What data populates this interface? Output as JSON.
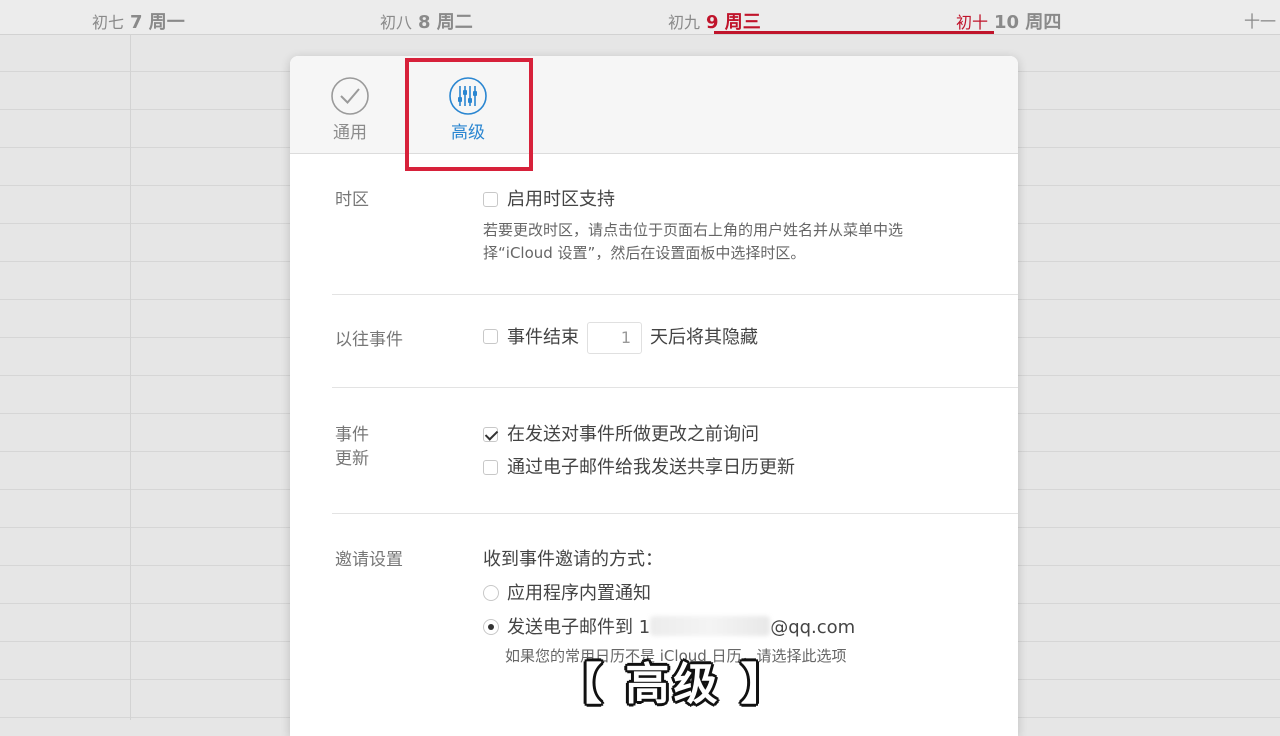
{
  "calendar": {
    "days": [
      {
        "lunar": "初七",
        "date": "7 周一"
      },
      {
        "lunar": "初八",
        "date": "8 周二"
      },
      {
        "lunar": "初九",
        "date": "9 周三"
      },
      {
        "lunar": "初十",
        "date": "10 周四"
      },
      {
        "lunar": "十一",
        "date": ""
      }
    ],
    "today_color": "#c0142b"
  },
  "tabs": {
    "general": {
      "label": "通用",
      "icon": "checkmark-circle-icon"
    },
    "advanced": {
      "label": "高级",
      "icon": "sliders-icon",
      "active": true
    }
  },
  "sections": {
    "timezone": {
      "label": "时区",
      "checkbox_label": "启用时区支持",
      "checked": false,
      "note_line1": "若要更改时区，请点击位于页面右上角的用户姓名并从菜单中选",
      "note_line2": "择“iCloud 设置”，然后在设置面板中选择时区。"
    },
    "past_events": {
      "label": "以往事件",
      "prefix": "事件结束",
      "days_value": "1",
      "suffix": "天后将其隐藏",
      "checked": false
    },
    "event_updates": {
      "label_line1": "事件",
      "label_line2": "更新",
      "option1": "在发送对事件所做更改之前询问",
      "option1_checked": true,
      "option2": "通过电子邮件给我发送共享日历更新",
      "option2_checked": false
    },
    "invitations": {
      "label": "邀请设置",
      "heading": "收到事件邀请的方式：",
      "option1": "应用程序内置通知",
      "option2_prefix": "发送电子邮件到 1",
      "option2_suffix": "@qq.com",
      "note": "如果您的常用日历不是 iCloud 日历，请选择此选项"
    }
  },
  "caption": "【 高级 】",
  "accent_color": "#2a86d1",
  "highlight_color": "#d7213a"
}
